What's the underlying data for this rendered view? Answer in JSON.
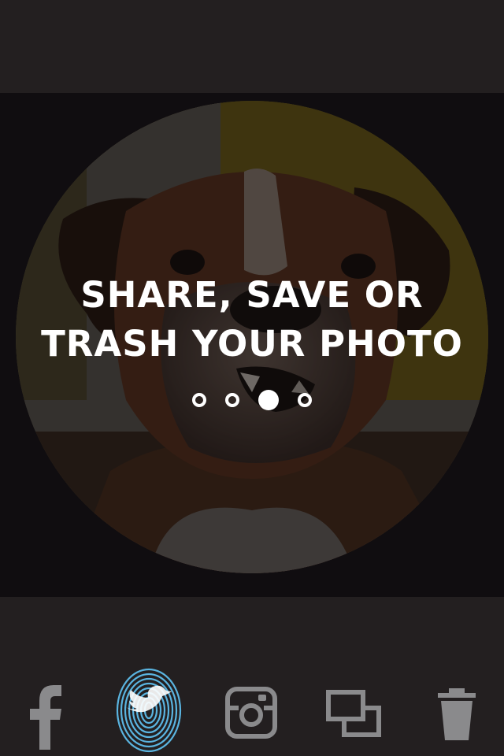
{
  "overlay": {
    "title_line1": "SHARE, SAVE OR",
    "title_line2": "TRASH YOUR PHOTO"
  },
  "pager": {
    "total": 4,
    "active_index": 2
  },
  "share_bar": {
    "buttons": [
      {
        "icon": "facebook-icon"
      },
      {
        "icon": "twitter-fingerprint-icon",
        "state": "pressed"
      },
      {
        "icon": "instagram-icon"
      },
      {
        "icon": "save-copy-icon"
      },
      {
        "icon": "trash-icon"
      }
    ]
  },
  "colors": {
    "background": "#231f20",
    "stage": "#100d10",
    "icon_gray": "#8a8a8c",
    "twitter_blue": "#5ab4e0",
    "white": "#ffffff"
  }
}
